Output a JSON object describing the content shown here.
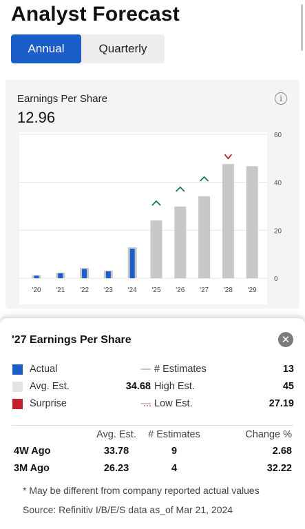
{
  "page": {
    "title": "Analyst Forecast"
  },
  "toggle": {
    "annual": "Annual",
    "quarterly": "Quarterly",
    "selected": "Annual"
  },
  "chart_card": {
    "title": "Earnings Per Share",
    "value": "12.96",
    "info_icon": "info-icon"
  },
  "chart_data": {
    "type": "bar",
    "categories": [
      "'20",
      "'21",
      "'22",
      "'23",
      "'24",
      "'25",
      "'26",
      "'27",
      "'28",
      "'29"
    ],
    "y_ticks": [
      "0",
      "20",
      "40",
      "60"
    ],
    "ylim": [
      0,
      60
    ],
    "axis_side": "right",
    "grid": true,
    "series": [
      {
        "values": [
          1.1,
          2.1,
          3.9,
          2.9,
          12.3,
          null,
          null,
          null,
          null,
          null
        ],
        "color": "#1b5ec9"
      },
      {
        "values": [
          1.3,
          2.3,
          4.3,
          3.2,
          12.9,
          24.1,
          29.9,
          34.2,
          47.6,
          46.7
        ],
        "color": "#c8c8c8"
      }
    ],
    "surprise_markers": [
      {
        "category": "'25",
        "direction": "up",
        "color": "#1a7a4a"
      },
      {
        "category": "'26",
        "direction": "up",
        "color": "#1a7a4a"
      },
      {
        "category": "'27",
        "direction": "up",
        "color": "#1a7a4a"
      },
      {
        "category": "'28",
        "direction": "down",
        "color": "#c4202b"
      }
    ]
  },
  "details": {
    "title": "'27 Earnings Per Share",
    "close_icon": "close-icon",
    "legend": [
      {
        "label": "Actual",
        "value": "—",
        "color": "#1b5ec9",
        "sep": "",
        "stat_label": "# Estimates",
        "stat_value": "13"
      },
      {
        "label": "Avg. Est.",
        "value": "34.68",
        "color": "#e3e3e3",
        "sep": "...",
        "stat_label": "High Est.",
        "stat_value": "45"
      },
      {
        "label": "Surprise",
        "value": "—",
        "color": "#c4202b",
        "sep": "...",
        "stat_label": "Low Est.",
        "stat_value": "27.19"
      }
    ],
    "table": {
      "headers": [
        "",
        "Avg. Est.",
        "# Estimates",
        "Change %"
      ],
      "rows": [
        [
          "4W Ago",
          "33.78",
          "9",
          "2.68"
        ],
        [
          "3M Ago",
          "26.23",
          "4",
          "32.22"
        ]
      ]
    },
    "note": "* May be different from company reported actual values",
    "source": "Source: Refinitiv I/B/E/S data as_of Mar 21, 2024"
  },
  "colors": {
    "accent": "#1b5ec9",
    "up": "#1a7a4a",
    "down": "#c4202b"
  }
}
